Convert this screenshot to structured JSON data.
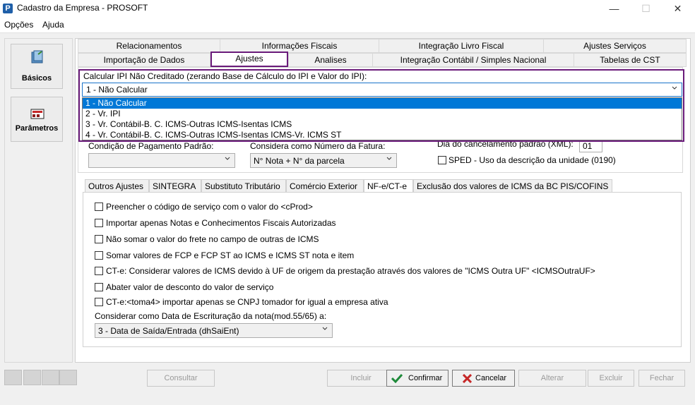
{
  "window": {
    "title": "Cadastro da Empresa - PROSOFT",
    "icon_letter": "P",
    "minimize": "—",
    "maximize": "☐",
    "close": "✕"
  },
  "menu": {
    "opcoes": "Opções",
    "ajuda": "Ajuda"
  },
  "sidebar": {
    "basicos": "Básicos",
    "parametros": "Parâmetros"
  },
  "tabs": {
    "row1": [
      "Relacionamentos",
      "Informações Fiscais",
      "Integração Livro Fiscal",
      "Ajustes Serviços"
    ],
    "row2": [
      "Importação de Dados",
      "Ajustes",
      "Analises",
      "Integração Contábil / Simples Nacional",
      "Tabelas de CST"
    ]
  },
  "ipi": {
    "label": "Calcular IPI Não Creditado (zerando Base de Cálculo do IPI e Valor do IPI):",
    "selected": "1 - Não Calcular",
    "options": [
      "1 - Não Calcular",
      "2 - Vr. IPI",
      "3 - Vr. Contábil-B. C. ICMS-Outras ICMS-Isentas ICMS",
      "4 - Vr. Contábil-B. C. ICMS-Outras ICMS-Isentas ICMS-Vr. ICMS ST"
    ]
  },
  "fields": {
    "dia_cancel_label": "Dia do cancelamento padrão (XML):",
    "dia_cancel_value": "01",
    "cond_pag_label": "Condição de Pagamento Padrão:",
    "cond_pag_value": "",
    "num_fatura_label": "Considera como Número da Fatura:",
    "num_fatura_value": "N° Nota + N° da parcela",
    "sped_label": "SPED - Uso da descrição da unidade (0190)"
  },
  "lower_tabs": [
    "Outros Ajustes",
    "SINTEGRA",
    "Substituto Tributário",
    "Comércio Exterior",
    "NF-e/CT-e",
    "Exclusão dos valores de ICMS da BC PIS/COFINS"
  ],
  "nfe": {
    "checks": [
      "Preencher o código de serviço com o valor do <cProd>",
      "Importar apenas Notas e Conhecimentos Fiscais Autorizadas",
      "Não somar o valor do frete no campo de outras de ICMS",
      "Somar valores de FCP e FCP ST ao ICMS e ICMS ST nota e item",
      "CT-e: Considerar valores de ICMS devido à UF de origem da prestação através dos valores de \"ICMS Outra UF\" <ICMSOutraUF>",
      "Abater valor de desconto do valor de serviço",
      "CT-e:<toma4> importar apenas se CNPJ tomador for igual a empresa ativa"
    ],
    "data_escrit_label": "Considerar como Data de Escrituração da nota(mod.55/65) a:",
    "data_escrit_value": "3 -  Data de Saída/Entrada (dhSaiEnt)"
  },
  "buttons": {
    "consultar": "Consultar",
    "incluir": "Incluir",
    "confirmar": "Confirmar",
    "cancelar": "Cancelar",
    "alterar": "Alterar",
    "excluir": "Excluir",
    "fechar": "Fechar"
  },
  "colors": {
    "highlight_border": "#6a1b7a",
    "selection": "#0078d7",
    "confirm_check": "#1e8a3a",
    "cancel_x": "#c62828"
  }
}
